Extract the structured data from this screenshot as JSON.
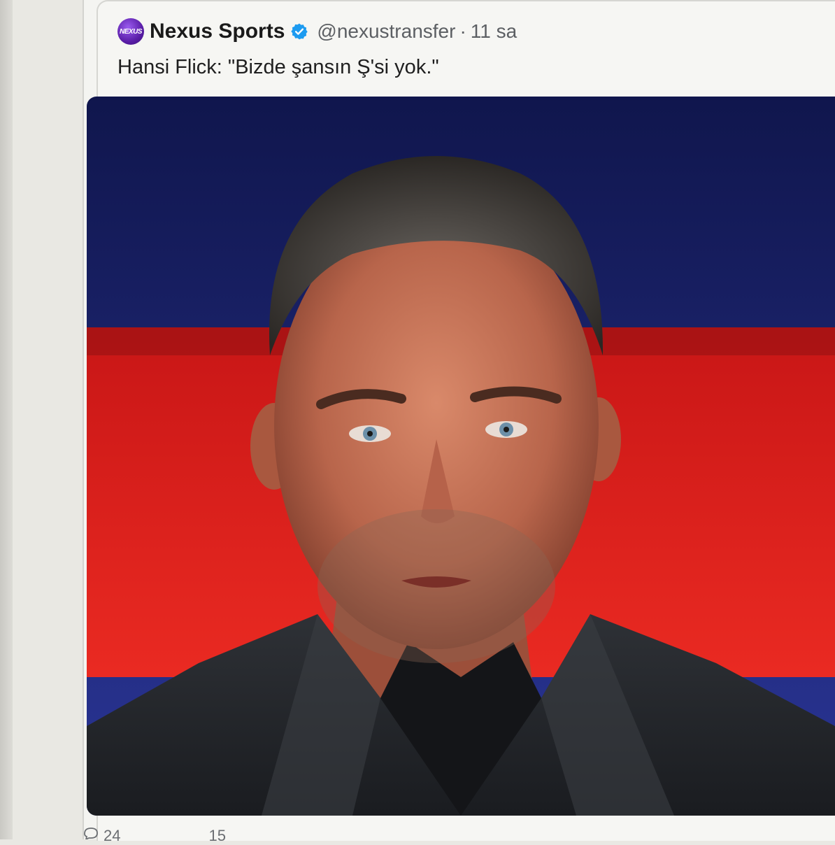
{
  "tweet": {
    "display_name": "Nexus Sports",
    "avatar_text": "NEXUS",
    "verified_icon": "verified-badge-icon",
    "handle": "@nexustransfer",
    "separator": "·",
    "time": "11 sa",
    "text": "Hansi Flick: \"Bizde şansın Ş'si yok.\""
  },
  "photo": {
    "subject": "man-portrait"
  },
  "actions": {
    "reply_count": "24",
    "retweet_count": "15"
  },
  "colors": {
    "avatar": "#6a2bc0",
    "verified": "#1d9bf0",
    "background_blue": "#1f2a8a",
    "background_red": "#d81a1a"
  }
}
